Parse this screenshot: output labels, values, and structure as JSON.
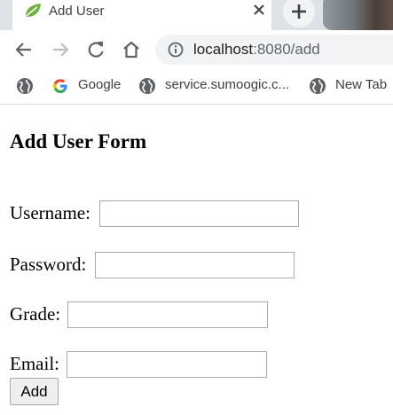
{
  "browser": {
    "tab": {
      "title": "Add User",
      "favicon": "spring-leaf-icon",
      "close_icon": "close-icon"
    },
    "new_tab_icon": "plus-icon",
    "address": {
      "host": "localhost",
      "path": ":8080/add",
      "security_icon": "info-icon"
    },
    "nav_icons": [
      "back-icon",
      "forward-icon",
      "reload-icon",
      "home-icon"
    ],
    "bookmarks": [
      {
        "label": "",
        "icon": "globe-icon"
      },
      {
        "label": "Google",
        "icon": "google-icon"
      },
      {
        "label": "service.sumoogic.c...",
        "icon": "globe-icon"
      },
      {
        "label": "New Tab",
        "icon": "globe-icon"
      }
    ]
  },
  "page": {
    "title": "Add User Form",
    "fields": [
      {
        "label": "Username:",
        "value": ""
      },
      {
        "label": "Password:",
        "value": ""
      },
      {
        "label": "Grade:",
        "value": ""
      },
      {
        "label": "Email:",
        "value": ""
      }
    ],
    "submit_label": "Add"
  },
  "colors": {
    "tab_strip": "#dee1e6",
    "omnibox": "#f1f3f4",
    "icon": "#5f6368",
    "spring_green": "#6db33f",
    "google_blue": "#4285f4",
    "google_red": "#ea4335",
    "google_yellow": "#fbbc05",
    "google_green": "#34a853"
  }
}
